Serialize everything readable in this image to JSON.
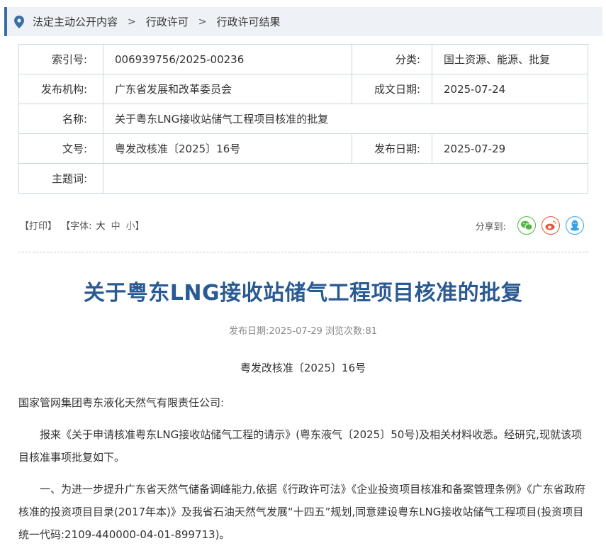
{
  "breadcrumb": {
    "items": [
      "法定主动公开内容",
      "行政许可",
      "行政许可结果"
    ],
    "separator": ">"
  },
  "meta": {
    "index_label": "索引号:",
    "index_value": "006939756/2025-00236",
    "category_label": "分类:",
    "category_value": "国土资源、能源、批复",
    "publisher_label": "发布机构:",
    "publisher_value": "广东省发展和改革委员会",
    "written_date_label": "成文日期:",
    "written_date_value": "2025-07-24",
    "name_label": "名称:",
    "name_value": "关于粤东LNG接收站储气工程项目核准的批复",
    "docno_label": "文号:",
    "docno_value": "粤发改核准〔2025〕16号",
    "pub_date_label": "发布日期:",
    "pub_date_value": "2025-07-29",
    "subject_label": "主题词:",
    "subject_value": ""
  },
  "toolbar": {
    "print": "【打印】",
    "font_prefix": "【字体:",
    "font_large": "大",
    "font_medium": "中",
    "font_small": "小",
    "font_suffix": "】",
    "share_label": "分享到:"
  },
  "colors": {
    "wechat": "#4db83f",
    "weibo": "#e8543e",
    "qq": "#3aa2e0",
    "title": "#2a5a93",
    "accent": "#3a6ea5"
  },
  "article": {
    "title": "关于粤东LNG接收站储气工程项目核准的批复",
    "pub_info": "发布日期:2025-07-29  浏览次数:81",
    "doc_no": "粤发改核准〔2025〕16号",
    "paragraphs": [
      "国家管网集团粤东液化天然气有限责任公司:",
      "报来《关于申请核准粤东LNG接收站储气工程的请示》(粤东液气〔2025〕50号)及相关材料收悉。经研究,现就该项目核准事项批复如下。",
      "一、为进一步提升广东省天然气储备调峰能力,依据《行政许可法》《企业投资项目核准和备案管理条例》《广东省政府核准的投资项目目录(2017年本)》及我省石油天然气发展“十四五”规划,同意建设粤东LNG接收站储气工程项目(投资项目统一代码:2109-440000-04-01-899713)。"
    ]
  }
}
